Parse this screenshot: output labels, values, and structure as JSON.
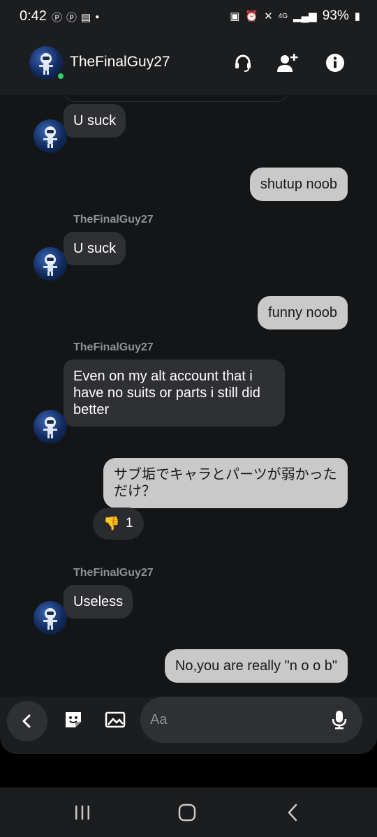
{
  "status_bar": {
    "time": "0:42",
    "left_icons": [
      "playstation-icon",
      "playstation-icon",
      "calendar-icon",
      "dot-icon"
    ],
    "network": "4G",
    "battery": "93%"
  },
  "header": {
    "contact_name": "TheFinalGuy27",
    "online": true,
    "icons": [
      "headset-icon",
      "add-friend-icon",
      "info-icon"
    ]
  },
  "messages": [
    {
      "direction": "in",
      "text": "U suck"
    },
    {
      "direction": "out",
      "text": "shutup noob"
    },
    {
      "direction": "in",
      "sender": "TheFinalGuy27",
      "text": "U suck"
    },
    {
      "direction": "out",
      "text": "funny noob"
    },
    {
      "direction": "in",
      "sender": "TheFinalGuy27",
      "text": "Even on my alt account that i have no suits or parts i still did better"
    },
    {
      "direction": "out",
      "text": "サブ垢でキャラとパーツが弱かっただけ？",
      "reaction": {
        "emoji": "👎",
        "count": "1"
      }
    },
    {
      "direction": "in",
      "sender": "TheFinalGuy27",
      "text": "Useless"
    },
    {
      "direction": "out",
      "text": "No,you are really \"n o o b\""
    }
  ],
  "composer": {
    "placeholder": "Aa",
    "icons": [
      "back-icon",
      "sticker-icon",
      "image-icon",
      "microphone-icon"
    ]
  },
  "nav": [
    "recent-apps-icon",
    "home-icon",
    "back-icon"
  ]
}
